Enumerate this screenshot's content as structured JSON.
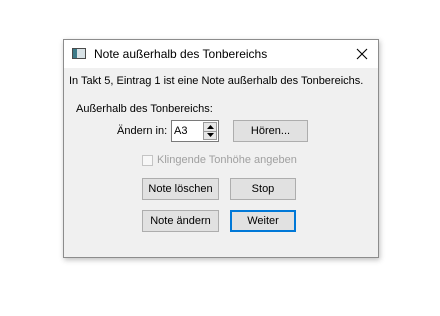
{
  "dialog": {
    "title": "Note außerhalb des Tonbereichs",
    "icon": "app-window-icon",
    "close_icon": "close-icon",
    "message": "In Takt 5, Eintrag 1 ist eine Note außerhalb des Tonbereichs.",
    "group_label": "Außerhalb des Tonbereichs:",
    "change_label": "Ändern in:",
    "pitch_value": "A3",
    "listen_button": "Hören...",
    "checkbox_label": "Klingende Tonhöhe angeben",
    "checkbox_checked": false,
    "checkbox_enabled": false,
    "delete_button": "Note löschen",
    "stop_button": "Stop",
    "change_button": "Note ändern",
    "continue_button": "Weiter",
    "accent_color": "#0078d7"
  }
}
